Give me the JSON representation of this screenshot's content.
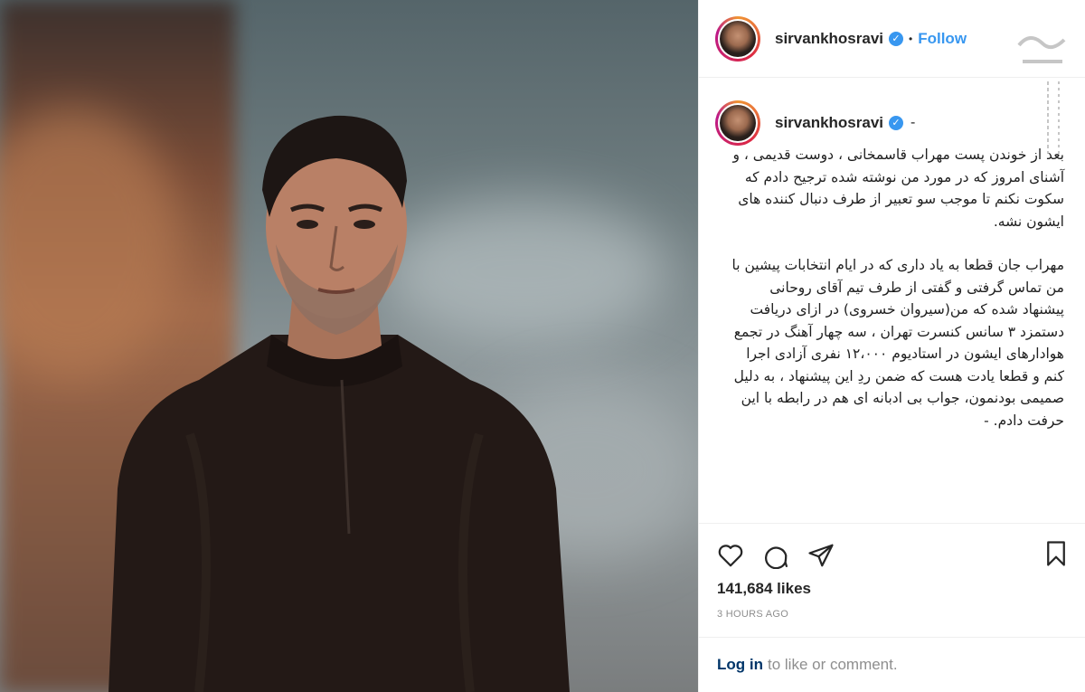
{
  "post": {
    "username": "sirvankhosravi",
    "verified_symbol": "✓",
    "separator": "•",
    "follow_label": "Follow",
    "caption_dash": "-",
    "caption_paragraphs": [
      "بعد از خوندن پست مهراب قاسمخانی ، دوست قدیمی ، و آشنای امروز که در مورد من نوشته شده ترجیح دادم که سکوت نکنم تا موجب سو تعبیر از طرف دنبال کننده های ایشون نشه.",
      "مهراب جان قطعا به یاد داری که در ایام انتخابات پیشین با من تماس گرفتی و گفتی از طرف تیم آقای روحانی پیشنهاد شده که من(سیروان خسروی) در ازای دریافت دستمزد ۳ سانس کنسرت تهران ، سه چهار آهنگ در تجمع هوادارهای ایشون در استادیوم ۱۲،۰۰۰ نفری آزادی اجرا کنم و قطعا یادت هست که ضمن ردِ این پیشنهاد ، به دلیل صمیمی بودنمون، جواب بی ادبانه ای هم در رابطه با این حرفت دادم. -"
    ],
    "likes": "141,684 likes",
    "time": "3 HOURS AGO",
    "login_label": "Log in",
    "comment_prompt": "to like or comment."
  },
  "icons": {
    "like": "heart-icon",
    "comment": "comment-icon",
    "share": "share-icon",
    "save": "bookmark-icon"
  },
  "colors": {
    "accent": "#3897f0",
    "text": "#262626",
    "muted": "#8e8e8e",
    "login": "#003569"
  }
}
